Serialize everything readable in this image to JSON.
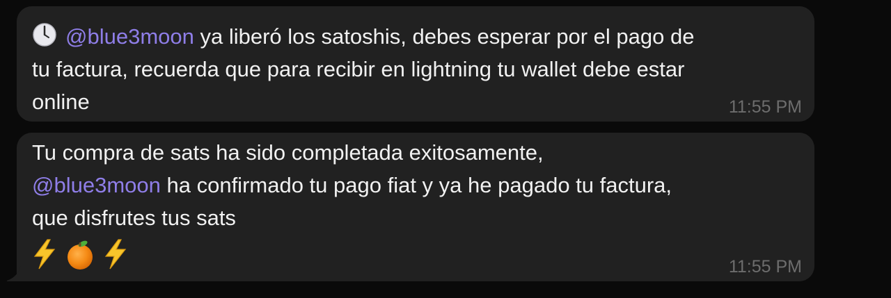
{
  "messages": [
    {
      "mention": "@blue3moon",
      "text_after_mention": " ya liberó los satoshis, debes esperar por el pago de",
      "line2": "tu factura, recuerda que para recibir en lightning tu wallet debe estar",
      "line3": "online",
      "time": "11:55 PM",
      "icon": "clock-icon"
    },
    {
      "line1": "Tu compra de sats ha sido completada exitosamente,",
      "mention": "@blue3moon",
      "text_after_mention": " ha confirmado tu pago fiat y ya he pagado tu factura,",
      "line3": "que disfrutes tus sats",
      "emojis": [
        "lightning-bolt-icon",
        "orange-icon",
        "lightning-bolt-icon"
      ],
      "time": "11:55 PM"
    }
  ],
  "colors": {
    "background": "#0a0a0a",
    "bubble": "#212121",
    "text": "#f1f1f1",
    "mention": "#8f7ee8",
    "timestamp": "#6d6d6d"
  }
}
